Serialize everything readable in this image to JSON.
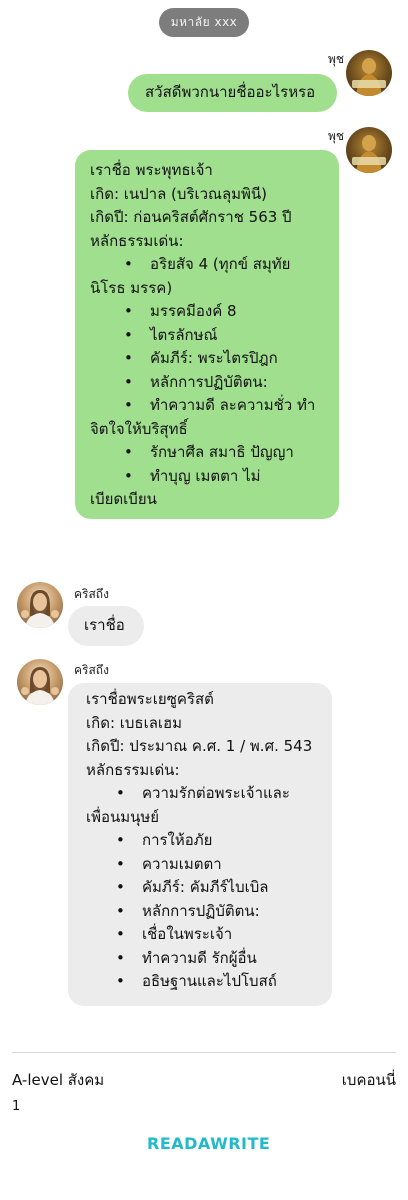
{
  "header": {
    "room_name": "มหาลัย xxx"
  },
  "messages": [
    {
      "sender": "พุช",
      "side": "right",
      "avatar_icon": "buddha-statue-icon",
      "avatar_caption": "ไลน์พระพุทธ",
      "lines": [
        "สวัสดีพวกนายชื่ออะไรหรอ"
      ]
    },
    {
      "sender": "พุช",
      "side": "right",
      "avatar_icon": "buddha-statue-icon",
      "avatar_caption": "ไลน์พระพุทธ",
      "lines": [
        "เราชื่อ พระพุทธเจ้า",
        "เกิด: เนปาล (บริเวณลุมพินี)",
        "เกิดปี: ก่อนคริสต์ศักราช 563 ปี",
        "หลักธรรมเด่น:",
        "อริยสัจ 4 (ทุกข์ สมุทัย",
        "นิโรธ มรรค)",
        "มรรคมีองค์ 8",
        "ไตรลักษณ์",
        "คัมภีร์: พระไตรปิฎก",
        "หลักการปฏิบัติตน:",
        "ทำความดี ละความชั่ว ทำ",
        "จิตใจให้บริสุทธิ์",
        "รักษาศีล สมาธิ ปัญญา",
        "ทำบุญ เมตตา ไม่",
        "เบียดเบียน"
      ]
    },
    {
      "sender": "คริสถึง",
      "side": "left",
      "avatar_icon": "jesus-portrait-icon",
      "lines": [
        "เราชื่อ"
      ]
    },
    {
      "sender": "คริสถึง",
      "side": "left",
      "avatar_icon": "jesus-portrait-icon",
      "lines": [
        "เราชื่อพระเยซูคริสต์",
        "เกิด: เบธเลเฮม",
        "เกิดปี: ประมาณ ค.ศ. 1 / พ.ศ. 543",
        "หลักธรรมเด่น:",
        "ความรักต่อพระเจ้าและ",
        "เพื่อนมนุษย์",
        "การให้อภัย",
        "ความเมตตา",
        "คัมภีร์: คัมภีร์ไบเบิล",
        "หลักการปฏิบัติตน:",
        "เชื่อในพระเจ้า",
        "ทำความดี รักผู้อื่น",
        "อธิษฐานและไปโบสถ์"
      ]
    }
  ],
  "bullet": "•",
  "footer": {
    "story_title": "A-level สังคม",
    "author": "เบคอนนี่",
    "page_number": "1",
    "logo_text": "READAWRITE"
  },
  "colors": {
    "my_bubble": "#a0df8e",
    "other_bubble": "#ececec",
    "pill": "#7d7d7d",
    "logo": "#22b9c8"
  }
}
